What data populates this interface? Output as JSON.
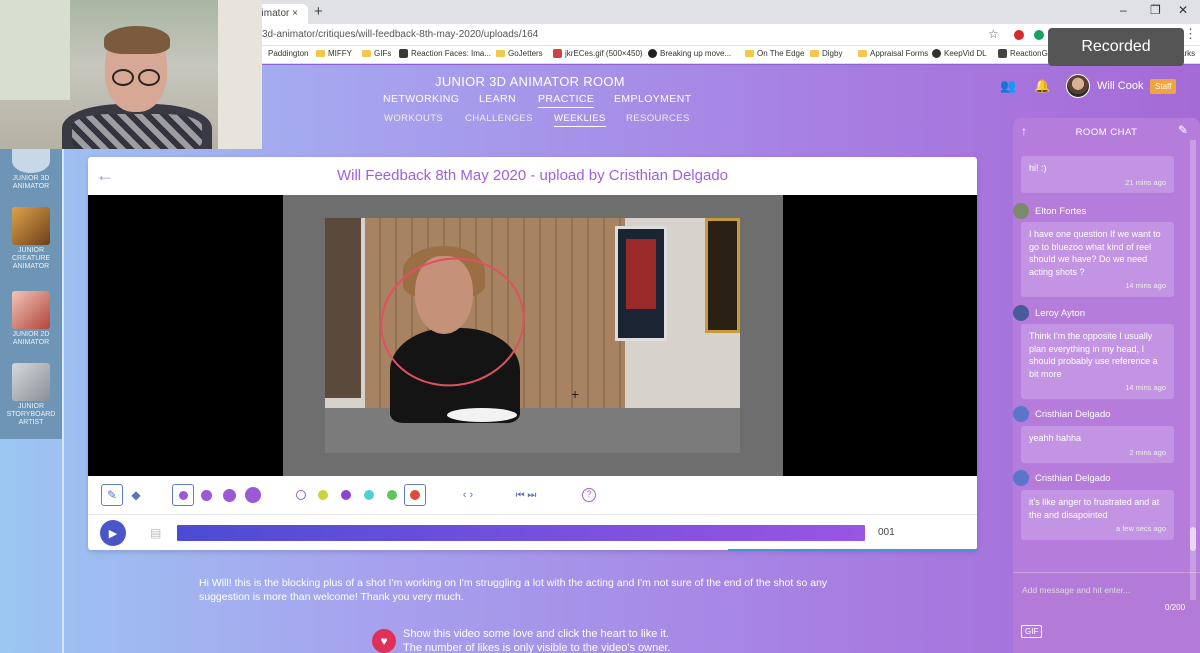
{
  "browser": {
    "tab_title": "nimator ×",
    "tab_close": "×",
    "new_tab": "+",
    "url": "3d-animator/critiques/will-feedback-8th-may-2020/uploads/164",
    "window_controls": [
      "–",
      "❐",
      "✕"
    ],
    "star_icon": "☆",
    "menu_icon": "⋮",
    "bookmarks": [
      {
        "label": "Paddington",
        "icon": "folder"
      },
      {
        "label": "MIFFY",
        "icon": "folder"
      },
      {
        "label": "GIFs",
        "icon": "folder"
      },
      {
        "label": "Reaction Faces: Ima...",
        "icon": "site"
      },
      {
        "label": "GoJetters",
        "icon": "folder"
      },
      {
        "label": "jkrECes.gif (500×450)",
        "icon": "site"
      },
      {
        "label": "Breaking up move...",
        "icon": "site"
      },
      {
        "label": "On The Edge",
        "icon": "folder"
      },
      {
        "label": "Digby",
        "icon": "folder"
      },
      {
        "label": "Appraisal Forms",
        "icon": "folder"
      },
      {
        "label": "KeepVid DL",
        "icon": "site"
      },
      {
        "label": "ReactionG",
        "icon": "site"
      },
      {
        "label": "arks",
        "icon": "none"
      }
    ]
  },
  "recorded_label": "Recorded",
  "header": {
    "room_title": "JUNIOR 3D ANIMATOR ROOM",
    "nav_primary": [
      "NETWORKING",
      "LEARN",
      "PRACTICE",
      "EMPLOYMENT"
    ],
    "nav_primary_active": "PRACTICE",
    "nav_secondary": [
      "WORKOUTS",
      "CHALLENGES",
      "WEEKLIES",
      "RESOURCES"
    ],
    "nav_secondary_active": "WEEKLIES",
    "user_name": "Will Cook",
    "user_badge": "Staff",
    "group_icon": "👥",
    "bell_icon": "🔔"
  },
  "rooms": [
    {
      "label": "JUNIOR 3D ANIMATOR",
      "color": "#c9d7ea"
    },
    {
      "label": "JUNIOR CREATURE ANIMATOR",
      "color": "#c98d3a"
    },
    {
      "label": "JUNIOR 2D ANIMATOR",
      "color": "#e8b8b0"
    },
    {
      "label": "JUNIOR STORYBOARD ARTIST",
      "color": "#b8bcc4"
    }
  ],
  "critique": {
    "title": "Will Feedback 8th May 2020 - upload by Cristhian Delgado",
    "back_icon": "←",
    "frame_number": "001",
    "prev_next": "‹ ›",
    "skip_icons": "⏮ ⏭",
    "help_icon": "?",
    "play_icon": "▶",
    "description": "Hi Will! this is the blocking plus of a shot I'm working on I'm struggling a lot with the acting and I'm not sure of the end of the shot so any suggestion is more than welcome! Thank you very much.",
    "like_line1": "Show this video some love and click the heart to like it.",
    "like_line2": "The number of likes is only visible to the video's owner.",
    "heart_icon": "♥"
  },
  "brush_colors": [
    "#9b59d6",
    "#c8d43a",
    "#8e44ce",
    "#4fd0d6",
    "#5cc65a",
    "#e04b3c"
  ],
  "brush_size_color": "#9b59d6",
  "chat": {
    "title": "ROOM CHAT",
    "up_icon": "↑",
    "edit_icon": "✎",
    "messages": [
      {
        "user": "",
        "text": "hi! :)",
        "time": "21 mins ago"
      },
      {
        "user": "Elton Fortes",
        "text": "I have one question If we want to go to bluezoo  what kind of reel should we have? Do we need acting shots ?",
        "time": "14 mins ago"
      },
      {
        "user": "Leroy Ayton",
        "text": "Think I'm the opposite I usually plan everything in my head, I should probably use reference a bit more",
        "time": "14 mins ago"
      },
      {
        "user": "Cristhian Delgado",
        "text": "yeahh hahha",
        "time": "2 mins ago"
      },
      {
        "user": "Cristhian Delgado",
        "text": "it's like anger to frustrated and at the and disapointed",
        "time": "a few secs ago"
      }
    ],
    "input_placeholder": "Add message and hit enter...",
    "char_counter": "0/200",
    "gif_label": "GIF"
  }
}
